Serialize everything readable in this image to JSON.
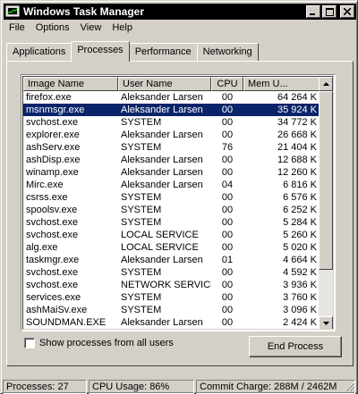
{
  "window": {
    "title": "Windows Task Manager"
  },
  "menu": [
    "File",
    "Options",
    "View",
    "Help"
  ],
  "tabs": [
    "Applications",
    "Processes",
    "Performance",
    "Networking"
  ],
  "active_tab": "Processes",
  "columns": [
    "Image Name",
    "User Name",
    "CPU",
    "Mem U..."
  ],
  "processes": [
    {
      "name": "firefox.exe",
      "user": "Aleksander Larsen",
      "cpu": "00",
      "mem": "64 264 K"
    },
    {
      "name": "msnmsgr.exe",
      "user": "Aleksander Larsen",
      "cpu": "00",
      "mem": "35 924 K",
      "selected": true
    },
    {
      "name": "svchost.exe",
      "user": "SYSTEM",
      "cpu": "00",
      "mem": "34 772 K"
    },
    {
      "name": "explorer.exe",
      "user": "Aleksander Larsen",
      "cpu": "00",
      "mem": "26 668 K"
    },
    {
      "name": "ashServ.exe",
      "user": "SYSTEM",
      "cpu": "76",
      "mem": "21 404 K"
    },
    {
      "name": "ashDisp.exe",
      "user": "Aleksander Larsen",
      "cpu": "00",
      "mem": "12 688 K"
    },
    {
      "name": "winamp.exe",
      "user": "Aleksander Larsen",
      "cpu": "00",
      "mem": "12 260 K"
    },
    {
      "name": "Mirc.exe",
      "user": "Aleksander Larsen",
      "cpu": "04",
      "mem": "6 816 K"
    },
    {
      "name": "csrss.exe",
      "user": "SYSTEM",
      "cpu": "00",
      "mem": "6 576 K"
    },
    {
      "name": "spoolsv.exe",
      "user": "SYSTEM",
      "cpu": "00",
      "mem": "6 252 K"
    },
    {
      "name": "svchost.exe",
      "user": "SYSTEM",
      "cpu": "00",
      "mem": "5 284 K"
    },
    {
      "name": "svchost.exe",
      "user": "LOCAL SERVICE",
      "cpu": "00",
      "mem": "5 260 K"
    },
    {
      "name": "alg.exe",
      "user": "LOCAL SERVICE",
      "cpu": "00",
      "mem": "5 020 K"
    },
    {
      "name": "taskmgr.exe",
      "user": "Aleksander Larsen",
      "cpu": "01",
      "mem": "4 664 K"
    },
    {
      "name": "svchost.exe",
      "user": "SYSTEM",
      "cpu": "00",
      "mem": "4 592 K"
    },
    {
      "name": "svchost.exe",
      "user": "NETWORK SERVICE",
      "cpu": "00",
      "mem": "3 936 K"
    },
    {
      "name": "services.exe",
      "user": "SYSTEM",
      "cpu": "00",
      "mem": "3 760 K"
    },
    {
      "name": "ashMaiSv.exe",
      "user": "SYSTEM",
      "cpu": "00",
      "mem": "3 096 K"
    },
    {
      "name": "SOUNDMAN.EXE",
      "user": "Aleksander Larsen",
      "cpu": "00",
      "mem": "2 424 K"
    }
  ],
  "show_all_label": "Show processes from all users",
  "show_all_checked": false,
  "end_process_label": "End Process",
  "status": {
    "processes": "Processes: 27",
    "cpu": "CPU Usage: 86%",
    "commit": "Commit Charge: 288M / 2462M"
  },
  "colors": {
    "selection": "#0a246a",
    "face": "#d4d0c8"
  },
  "icons": {
    "app": "task-manager-icon",
    "minimize": "minimize-icon",
    "maximize": "maximize-icon",
    "close": "close-icon"
  }
}
